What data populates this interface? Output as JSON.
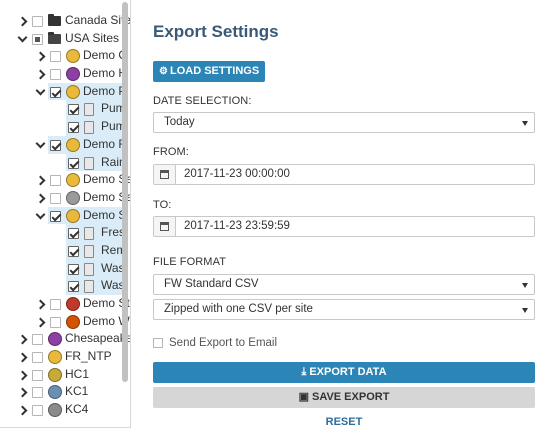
{
  "tree": {
    "rows": [
      {
        "label": "Canada Sites",
        "depth": 0,
        "toggle": "right",
        "check": "none",
        "icon": "folder-icon",
        "icon_color": "#333333",
        "selected": false
      },
      {
        "label": "USA Sites",
        "depth": 0,
        "toggle": "down",
        "check": "partial",
        "icon": "folder-open-icon",
        "icon_color": "#444444",
        "selected": false
      },
      {
        "label": "Demo C",
        "depth": 1,
        "toggle": "right",
        "check": "none",
        "icon": "site-icon",
        "icon_color": "#e8b93a",
        "selected": false
      },
      {
        "label": "Demo H",
        "depth": 1,
        "toggle": "right",
        "check": "none",
        "icon": "site-icon",
        "icon_color": "#8e3fa3",
        "selected": false
      },
      {
        "label": "Demo P",
        "depth": 1,
        "toggle": "down",
        "check": "checked",
        "icon": "site-icon",
        "icon_color": "#e8b93a",
        "selected": true
      },
      {
        "label": "Pum",
        "depth": 2,
        "toggle": "",
        "check": "checked",
        "icon": "doc-icon",
        "icon_color": "#e8e8e8",
        "selected": true
      },
      {
        "label": "Pum",
        "depth": 2,
        "toggle": "",
        "check": "checked",
        "icon": "doc-icon",
        "icon_color": "#e8e8e8",
        "selected": true
      },
      {
        "label": "Demo R",
        "depth": 1,
        "toggle": "down",
        "check": "checked",
        "icon": "site-icon",
        "icon_color": "#e8b93a",
        "selected": true
      },
      {
        "label": "Rain",
        "depth": 2,
        "toggle": "",
        "check": "checked",
        "icon": "doc-icon",
        "icon_color": "#e8e8e8",
        "selected": true
      },
      {
        "label": "Demo Sa",
        "depth": 1,
        "toggle": "right",
        "check": "none",
        "icon": "site-icon",
        "icon_color": "#e8b93a",
        "selected": false
      },
      {
        "label": "Demo Sa",
        "depth": 1,
        "toggle": "right",
        "check": "none",
        "icon": "site-icon",
        "icon_color": "#9a9a9a",
        "selected": false
      },
      {
        "label": "Demo S",
        "depth": 1,
        "toggle": "down",
        "check": "checked",
        "icon": "site-icon",
        "icon_color": "#e8b93a",
        "selected": true
      },
      {
        "label": "Fres",
        "depth": 2,
        "toggle": "",
        "check": "checked",
        "icon": "doc-icon",
        "icon_color": "#e8e8e8",
        "selected": true
      },
      {
        "label": "Rem",
        "depth": 2,
        "toggle": "",
        "check": "checked",
        "icon": "doc-icon",
        "icon_color": "#e8e8e8",
        "selected": true
      },
      {
        "label": "Wast",
        "depth": 2,
        "toggle": "",
        "check": "checked",
        "icon": "doc-icon",
        "icon_color": "#e8e8e8",
        "selected": true
      },
      {
        "label": "Wast",
        "depth": 2,
        "toggle": "",
        "check": "checked",
        "icon": "doc-icon",
        "icon_color": "#e8e8e8",
        "selected": true
      },
      {
        "label": "Demo St",
        "depth": 1,
        "toggle": "right",
        "check": "none",
        "icon": "site-icon",
        "icon_color": "#c0392b",
        "selected": false
      },
      {
        "label": "Demo W",
        "depth": 1,
        "toggle": "right",
        "check": "none",
        "icon": "site-icon",
        "icon_color": "#d35400",
        "selected": false
      },
      {
        "label": "Chesapeake",
        "depth": 0,
        "toggle": "right",
        "check": "none",
        "icon": "site-icon",
        "icon_color": "#8e3fa3",
        "selected": false
      },
      {
        "label": "FR_NTP",
        "depth": 0,
        "toggle": "right",
        "check": "none",
        "icon": "site-icon",
        "icon_color": "#e8b93a",
        "selected": false
      },
      {
        "label": "HC1",
        "depth": 0,
        "toggle": "right",
        "check": "none",
        "icon": "site-icon",
        "icon_color": "#c9a93a",
        "selected": false
      },
      {
        "label": "KC1",
        "depth": 0,
        "toggle": "right",
        "check": "none",
        "icon": "site-icon",
        "icon_color": "#6b8fb3",
        "selected": false
      },
      {
        "label": "KC4",
        "depth": 0,
        "toggle": "right",
        "check": "none",
        "icon": "site-icon",
        "icon_color": "#8a8a8a",
        "selected": false
      }
    ]
  },
  "export": {
    "title": "Export Settings",
    "load_settings_label": "LOAD SETTINGS",
    "date_selection_label": "DATE SELECTION:",
    "date_selection_value": "Today",
    "from_label": "FROM:",
    "from_value": "2017-11-23 00:00:00",
    "to_label": "TO:",
    "to_value": "2017-11-23 23:59:59",
    "file_format_label": "FILE FORMAT",
    "file_format_value": "FW Standard CSV",
    "packaging_value": "Zipped with one CSV per site",
    "send_email_label": "Send Export to Email",
    "export_data_label": "EXPORT DATA",
    "save_export_label": "SAVE EXPORT",
    "reset_label": "RESET"
  }
}
